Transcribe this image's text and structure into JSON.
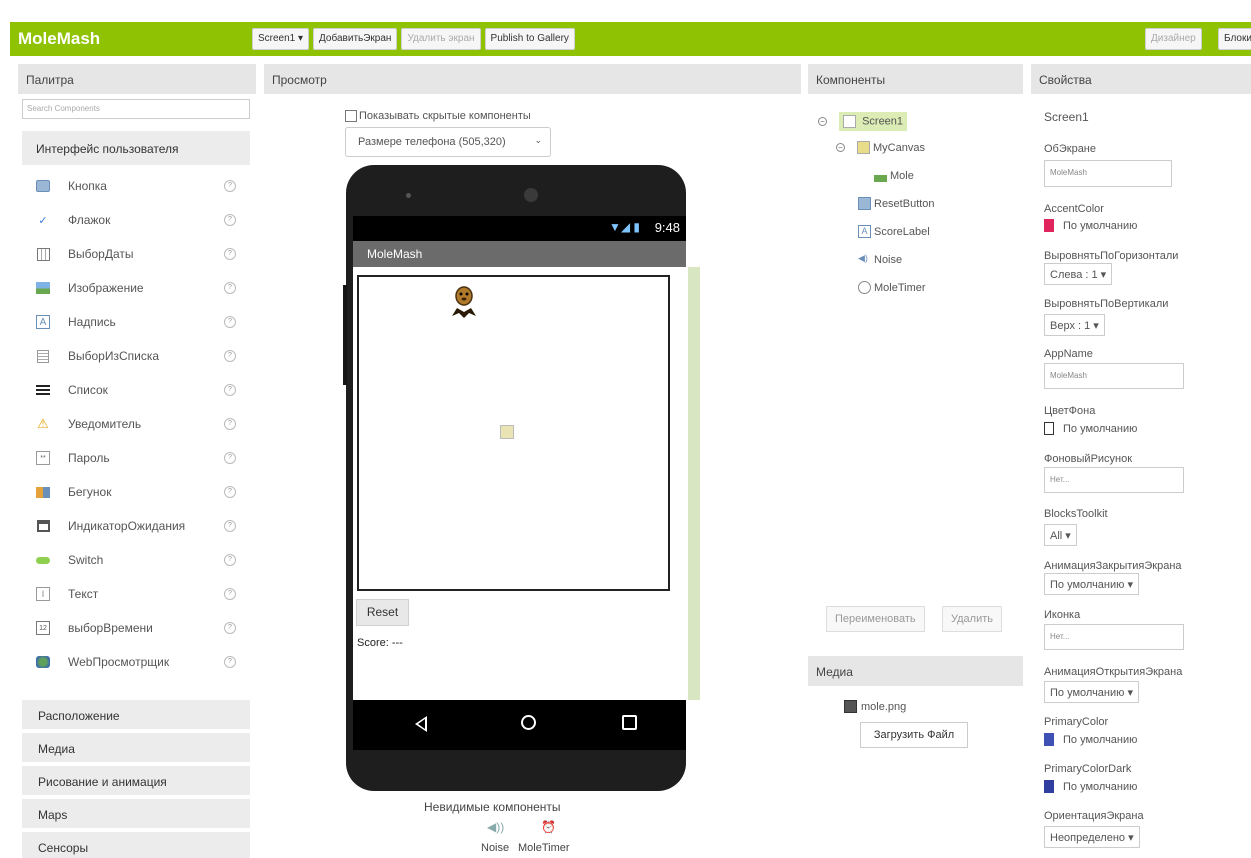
{
  "header": {
    "app_title": "MoleMash",
    "screen_selector": "Screen1 ▾",
    "add_screen": "ДобавитьЭкран",
    "remove_screen": "Удалить экран",
    "publish": "Publish to Gallery",
    "designer": "Дизайнер",
    "blocks": "Блоки"
  },
  "palette": {
    "title": "Палитра",
    "search_placeholder": "Search Components",
    "ui_category": "Интерфейс пользователя",
    "items": [
      {
        "label": "Кнопка",
        "icon": "button-icon"
      },
      {
        "label": "Флажок",
        "icon": "checkbox-icon"
      },
      {
        "label": "ВыборДаты",
        "icon": "date-picker-icon"
      },
      {
        "label": "Изображение",
        "icon": "image-icon"
      },
      {
        "label": "Надпись",
        "icon": "label-icon"
      },
      {
        "label": "ВыборИзСписка",
        "icon": "list-picker-icon"
      },
      {
        "label": "Список",
        "icon": "list-view-icon"
      },
      {
        "label": "Уведомитель",
        "icon": "notifier-icon"
      },
      {
        "label": "Пароль",
        "icon": "password-icon"
      },
      {
        "label": "Бегунок",
        "icon": "slider-icon"
      },
      {
        "label": "ИндикаторОжидания",
        "icon": "spinner-icon"
      },
      {
        "label": "Switch",
        "icon": "switch-icon"
      },
      {
        "label": "Текст",
        "icon": "textbox-icon"
      },
      {
        "label": "выборВремени",
        "icon": "time-picker-icon"
      },
      {
        "label": "WebПросмотрщик",
        "icon": "web-viewer-icon"
      }
    ],
    "help": "?",
    "categories": [
      "Расположение",
      "Медиа",
      "Рисование и анимация",
      "Maps",
      "Сенсоры"
    ]
  },
  "viewer": {
    "title": "Просмотр",
    "show_hidden": "Показывать скрытые компоненты",
    "phone_size": "Размере телефона (505,320)",
    "status_time": "9:48",
    "screen_title": "MoleMash",
    "reset_label": "Reset",
    "score_label": "Score: ---",
    "invisible_title": "Невидимые компоненты",
    "invisible": [
      "Noise",
      "MoleTimer"
    ]
  },
  "components": {
    "title": "Компоненты",
    "tree": {
      "screen": "Screen1",
      "canvas": "MyCanvas",
      "mole": "Mole",
      "reset": "ResetButton",
      "score": "ScoreLabel",
      "noise": "Noise",
      "timer": "MoleTimer"
    },
    "rename": "Переименовать",
    "delete": "Удалить"
  },
  "media": {
    "title": "Медиа",
    "file": "mole.png",
    "upload": "Загрузить Файл"
  },
  "properties": {
    "title": "Свойства",
    "component": "Screen1",
    "about_label": "ОбЭкране",
    "about_value": "MoleMash",
    "accent_label": "AccentColor",
    "accent_value": "По умолчанию",
    "accent_color": "#e0245e",
    "halign_label": "ВыровнятьПоГоризонтали",
    "halign_value": "Слева : 1 ▾",
    "valign_label": "ВыровнятьПоВертикали",
    "valign_value": "Верх : 1 ▾",
    "appname_label": "AppName",
    "appname_value": "MoleMash",
    "bgcolor_label": "ЦветФона",
    "bgcolor_value": "По умолчанию",
    "bgimage_label": "ФоновыйРисунок",
    "bgimage_value": "Нет...",
    "toolkit_label": "BlocksToolkit",
    "toolkit_value": "All ▾",
    "close_anim_label": "АнимацияЗакрытияЭкрана",
    "close_anim_value": "По умолчанию ▾",
    "icon_label": "Иконка",
    "icon_value": "Нет...",
    "open_anim_label": "АнимацияОткрытияЭкрана",
    "open_anim_value": "По умолчанию ▾",
    "primary_label": "PrimaryColor",
    "primary_value": "По умолчанию",
    "primary_color": "#3f51b5",
    "primary_dark_label": "PrimaryColorDark",
    "primary_dark_value": "По умолчанию",
    "primary_dark_color": "#303f9f",
    "orientation_label": "ОриентацияЭкрана",
    "orientation_value": "Неопределено ▾"
  }
}
